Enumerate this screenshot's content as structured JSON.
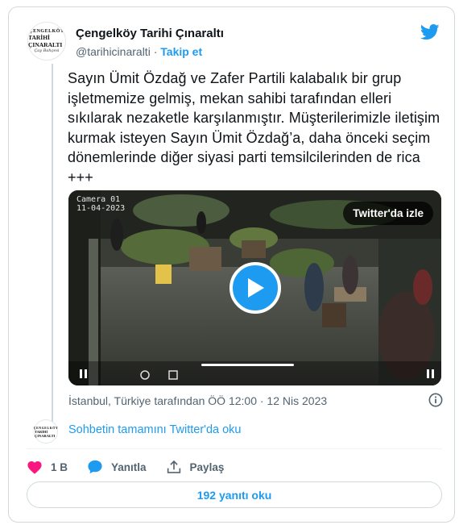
{
  "author": {
    "name": "Çengelköy Tarihi Çınaraltı",
    "handle": "@tarihicinaralti",
    "separator": "·",
    "follow_label": "Takip et",
    "logo_top": "ÇENGELKÖY",
    "logo_main": "TARİHİ ÇINARALTI",
    "logo_script": "Çay Bahçesi"
  },
  "tweet": {
    "text": "Sayın Ümit Özdağ ve Zafer Partili kalabalık bir grup işletmemize gelmiş, mekan sahibi tarafından elleri sıkılarak nezaketle karşılanmıştır. Müşterilerimizle iletişim kurmak isteyen Sayın Ümit Özdağ’a, daha önceki seçim dönemlerinde diğer siyasi parti temsilcilerinden de rica +++"
  },
  "media": {
    "camera_label": "Camera 01",
    "camera_date": "11-04-2023",
    "watch_label": "Twitter'da izle"
  },
  "meta": {
    "location_time": "İstanbul, Türkiye tarafından ÖÖ 12:00 · 12 Nis 2023"
  },
  "conversation": {
    "link_label": "Sohbetin tamamını Twitter'da oku"
  },
  "actions": {
    "like_count": "1 B",
    "reply_label": "Yanıtla",
    "share_label": "Paylaş"
  },
  "replies": {
    "button_label": "192 yanıtı oku"
  },
  "colors": {
    "accent": "#1d9bf0",
    "like": "#f91880",
    "text": "#0f1419",
    "secondary": "#536471"
  },
  "icons": [
    "twitter-bird-icon",
    "play-icon",
    "heart-icon",
    "reply-bubble-icon",
    "share-icon",
    "info-icon"
  ]
}
